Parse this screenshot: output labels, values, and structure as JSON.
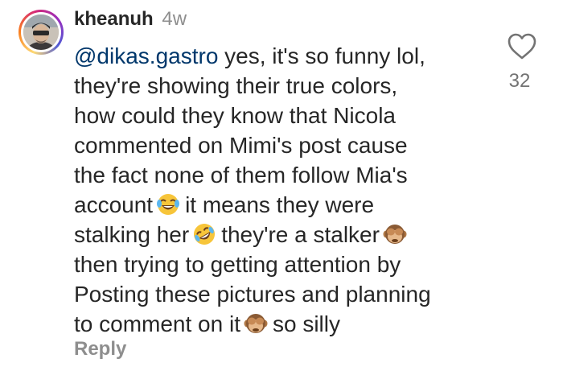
{
  "comment": {
    "username": "kheanuh",
    "time": "4w",
    "lines": [
      {
        "mention": "@dikas.gastro",
        "rest": "yes, it's so funny lol,"
      },
      {
        "text": "they're showing their true colors,"
      },
      {
        "text": "how could they know that Nicola"
      },
      {
        "text": "commented on Mimi's post cause"
      },
      {
        "text": "the fact none of them follow Mia's"
      },
      {
        "before": "account",
        "emoji": "face-with-tears-of-joy-emoji",
        "after": "it means they were"
      },
      {
        "before": "stalking her",
        "emoji": "rolling-on-floor-laughing-emoji",
        "after": "they're a stalker",
        "trailing_emoji": "see-no-evil-monkey-emoji"
      },
      {
        "text": "then trying to getting attention by"
      },
      {
        "text": "Posting these pictures and planning"
      },
      {
        "before": "to comment on it",
        "emoji": "see-no-evil-monkey-emoji",
        "after": "so silly"
      }
    ],
    "reply_label": "Reply",
    "like_count": "32",
    "like_icon": "heart-outline-icon",
    "colors": {
      "text": "#262626",
      "mention": "#00376b",
      "muted": "#8e8e8e"
    }
  }
}
